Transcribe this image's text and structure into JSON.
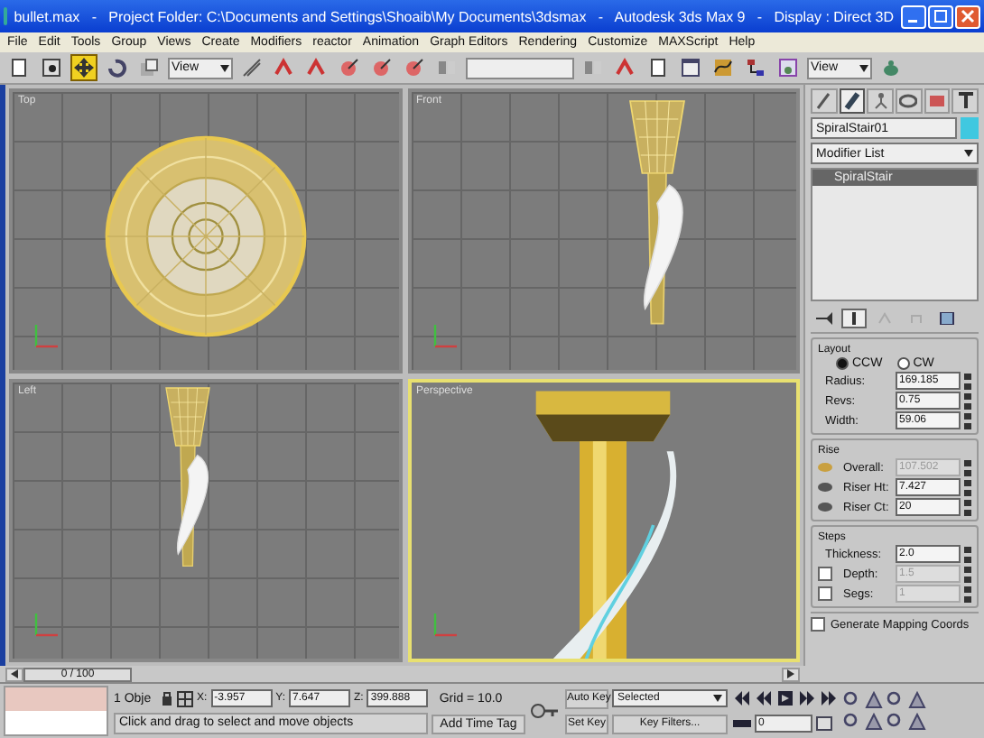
{
  "window": {
    "title": "bullet.max   -   Project Folder: C:\\Documents and Settings\\Shoaib\\My Documents\\3dsmax   -   Autodesk 3ds Max 9   -   Display : Direct 3D"
  },
  "menu": [
    "File",
    "Edit",
    "Tools",
    "Group",
    "Views",
    "Create",
    "Modifiers",
    "reactor",
    "Animation",
    "Graph Editors",
    "Rendering",
    "Customize",
    "MAXScript",
    "Help"
  ],
  "toolbar": {
    "tools": [
      {
        "kind": "page",
        "selected": false
      },
      {
        "kind": "select",
        "selected": false
      },
      {
        "kind": "move",
        "selected": true
      },
      {
        "kind": "rotate",
        "selected": false
      },
      {
        "kind": "scale",
        "selected": false
      },
      {
        "kind": "dropdown",
        "text": "View"
      },
      {
        "kind": "pivot",
        "selected": false
      },
      {
        "kind": "snap",
        "selected": false
      },
      {
        "kind": "snap",
        "selected": false
      },
      {
        "kind": "angle",
        "selected": false
      },
      {
        "kind": "angle",
        "selected": false
      },
      {
        "kind": "angle",
        "selected": false
      },
      {
        "kind": "mirror",
        "selected": false
      },
      {
        "kind": "wide"
      },
      {
        "kind": "mirror",
        "selected": false
      },
      {
        "kind": "snap",
        "selected": false
      },
      {
        "kind": "page",
        "selected": false
      },
      {
        "kind": "window",
        "selected": false
      },
      {
        "kind": "curve",
        "selected": false
      },
      {
        "kind": "schematic",
        "selected": false
      },
      {
        "kind": "render",
        "selected": false
      },
      {
        "kind": "dropdown",
        "text": "View"
      },
      {
        "kind": "teapot",
        "selected": false
      }
    ]
  },
  "viewports": [
    {
      "label": "Top",
      "kind": "top",
      "selected": false
    },
    {
      "label": "Front",
      "kind": "front",
      "selected": false
    },
    {
      "label": "Left",
      "kind": "left",
      "selected": false
    },
    {
      "label": "Perspective",
      "kind": "perspective",
      "selected": true
    }
  ],
  "command_panel": {
    "tabs": [
      {
        "selected": false
      },
      {
        "selected": true
      },
      {
        "selected": false
      },
      {
        "selected": false
      },
      {
        "selected": false
      },
      {
        "selected": false
      }
    ],
    "object_name": "SpiralStair01",
    "modifier_list": "Modifier List",
    "stack": [
      {
        "label": "SpiralStair",
        "selected": true
      }
    ],
    "layout": {
      "title": "Layout",
      "radios": [
        {
          "label": "CCW",
          "selected": true
        },
        {
          "label": "CW",
          "selected": false
        }
      ],
      "fields": [
        {
          "label": "Radius:",
          "value": "169.185"
        },
        {
          "label": "Revs:",
          "value": "0.75"
        },
        {
          "label": "Width:",
          "value": "59.06"
        }
      ]
    },
    "rise": {
      "title": "Rise",
      "fields": [
        {
          "label": "Overall:",
          "value": "107.502",
          "disabled": true
        },
        {
          "label": "Riser Ht:",
          "value": "7.427",
          "disabled": false
        },
        {
          "label": "Riser Ct:",
          "value": "20",
          "disabled": false
        }
      ]
    },
    "steps": {
      "title": "Steps",
      "fields": [
        {
          "kind": "plain",
          "label": "Thickness:",
          "value": "2.0"
        },
        {
          "kind": "checkbox",
          "label": "Depth:",
          "value": "1.5",
          "checked": false
        },
        {
          "kind": "checkbox",
          "label": "Segs:",
          "value": "1",
          "checked": false
        }
      ]
    },
    "mapping": {
      "label": "Generate Mapping Coords",
      "checked": false
    }
  },
  "time_slider": {
    "text": "0 / 100",
    "level": 0.0
  },
  "status_bar": {
    "selection": "1 Obje",
    "coords": [
      {
        "axis": "X:",
        "value": "-3.957"
      },
      {
        "axis": "Y:",
        "value": "7.647"
      },
      {
        "axis": "Z:",
        "value": "399.888"
      }
    ],
    "grid": "Grid = 10.0",
    "prompt": "Click and drag to select and move objects",
    "time_tag": "Add Time Tag",
    "auto_key": "Auto Key",
    "set_key": "Set Key",
    "key_mode": "Selected",
    "key_filters": "Key Filters...",
    "frame": "0"
  }
}
